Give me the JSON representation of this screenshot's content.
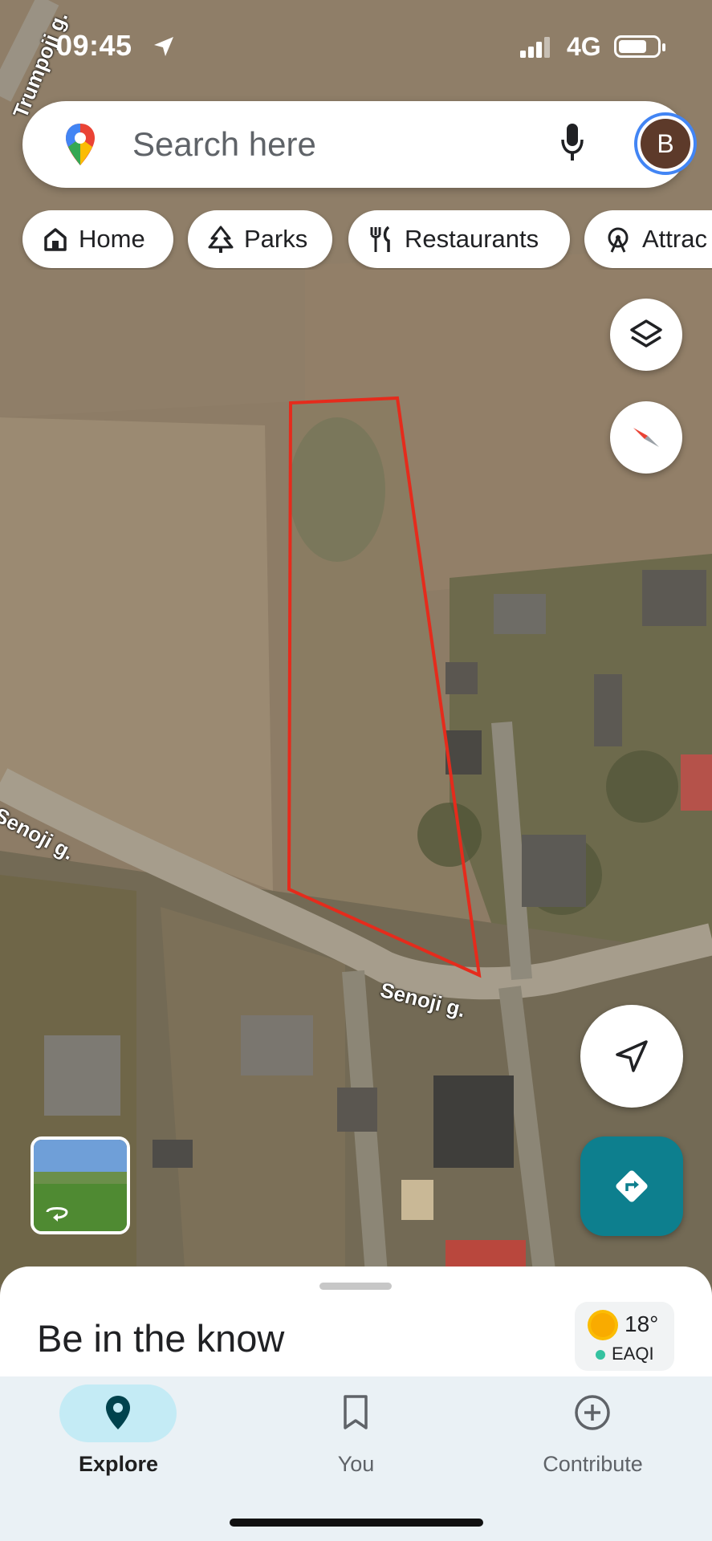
{
  "status_bar": {
    "time": "09:45",
    "network": "4G",
    "location_icon": "location-arrow-icon",
    "signal_icon": "signal-bars-icon",
    "battery_icon": "battery-icon"
  },
  "search": {
    "placeholder": "Search here",
    "mic_icon": "mic-icon",
    "avatar_letter": "B",
    "logo_icon": "google-maps-pin-icon"
  },
  "chips": [
    {
      "label": "Home",
      "icon": "home-icon"
    },
    {
      "label": "Parks",
      "icon": "tree-icon"
    },
    {
      "label": "Restaurants",
      "icon": "fork-knife-icon"
    },
    {
      "label": "Attrac",
      "icon": "ferris-wheel-icon"
    }
  ],
  "map": {
    "street_labels": [
      "Trumpoji g.",
      "Senoji g.",
      "Senoji g."
    ],
    "parcel_outline_color": "#e52b1c"
  },
  "buttons": {
    "layers_icon": "layers-icon",
    "compass_icon": "compass-icon",
    "recenter_icon": "navigation-arrow-icon",
    "directions_icon": "directions-icon",
    "street_view_icon": "360-rotate-icon"
  },
  "bottom_sheet": {
    "title": "Be in the know",
    "temperature": "18°",
    "aqi_label": "EAQI",
    "weather_icon": "sun-icon"
  },
  "nav": [
    {
      "label": "Explore",
      "icon": "location-pin-icon",
      "active": true
    },
    {
      "label": "You",
      "icon": "bookmark-icon",
      "active": false
    },
    {
      "label": "Contribute",
      "icon": "add-circle-icon",
      "active": false
    }
  ],
  "colors": {
    "accent": "#0d7f8e",
    "active_nav_pill": "#c4ebf5",
    "avatar_ring": "#4285f4"
  }
}
